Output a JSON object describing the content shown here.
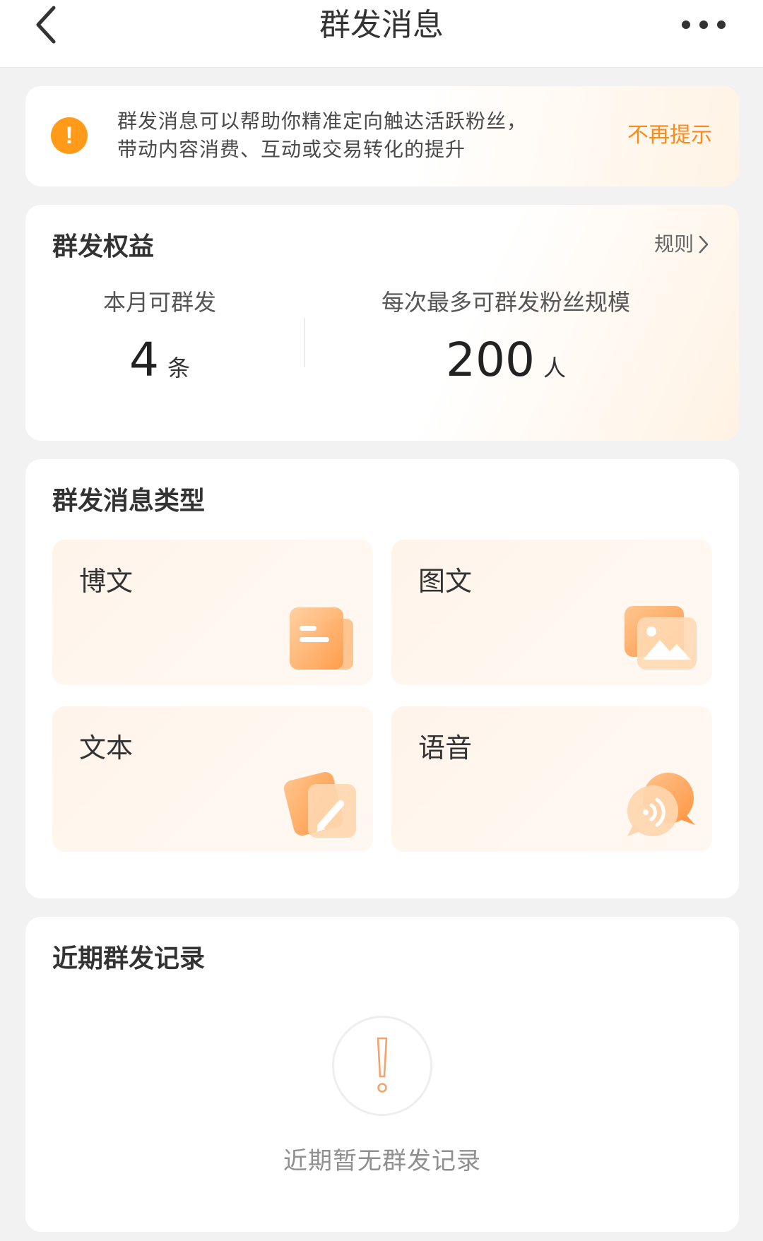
{
  "header": {
    "title": "群发消息"
  },
  "notice": {
    "line1": "群发消息可以帮助你精准定向触达活跃粉丝，",
    "line2": "带动内容消费、互动或交易转化的提升",
    "dismiss_label": "不再提示",
    "icon_glyph": "!"
  },
  "benefits": {
    "title": "群发权益",
    "rules_label": "规则",
    "monthly": {
      "label": "本月可群发",
      "value": "4",
      "unit": "条"
    },
    "max_fans": {
      "label": "每次最多可群发粉丝规模",
      "value": "200",
      "unit": "人"
    }
  },
  "types": {
    "title": "群发消息类型",
    "items": [
      {
        "label": "博文",
        "icon": "article-icon"
      },
      {
        "label": "图文",
        "icon": "image-icon"
      },
      {
        "label": "文本",
        "icon": "edit-icon"
      },
      {
        "label": "语音",
        "icon": "voice-icon"
      }
    ]
  },
  "records": {
    "title": "近期群发记录",
    "empty_text": "近期暂无群发记录"
  },
  "colors": {
    "accent": "#ff8a1a",
    "warning": "#ff9b19",
    "tile_bg": "#fff4ea"
  }
}
